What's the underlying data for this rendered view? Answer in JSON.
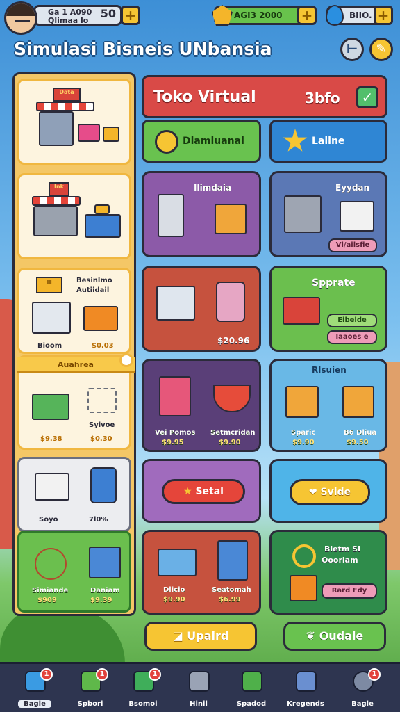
{
  "header": {
    "player_name": "Ga 1 A090",
    "player_level": "Qlimaa lo",
    "player_num": "50",
    "coins": "AGI3 2000",
    "diamonds": "BIIO.",
    "title": "Simulasi Bisneis UNbansia"
  },
  "left_panel": {
    "card3_title": "Besinlmo",
    "card3_sub": "Autiidail",
    "card3_label_a": "Bioom",
    "card3_price_a": "$0.03",
    "card4_banner": "Auahrea",
    "card4_price_a": "$9.38",
    "card4_label_b": "Syivoe",
    "card4_price_b": "$0.30",
    "card5_label_a": "Soyo",
    "card5_label_b": "7l0%",
    "card6_label_a": "Simiande",
    "card6_price_a": "$909",
    "card6_label_b": "Daniam",
    "card6_price_b": "$9.39"
  },
  "main": {
    "toko_title": "Toko Virtual",
    "toko_value": "3bfo",
    "btn_diam": "Diamluanal",
    "btn_lailne": "Lailne",
    "card_a_title": "Ilimdaia",
    "card_b_title": "Eyydan",
    "card_b_pill": "Vl/ailsfie",
    "card_c_price": "$20.96",
    "card_d_title": "Spprate",
    "card_d_pill1": "Eibelde",
    "card_d_pill2": "Iaaoes e",
    "card_e_label_a": "Vei Pomos",
    "card_e_price_a": "$9.95",
    "card_e_label_b": "Setmcridan",
    "card_e_price_b": "$9.90",
    "card_f_title": "Rlsuien",
    "card_f_label_a": "Sparic",
    "card_f_price_a": "$9.90",
    "card_f_label_b": "B6 Dliua",
    "card_f_price_b": "$9.50",
    "btn_setal": "Setal",
    "btn_svide": "Svide",
    "card_g_label_a": "Dlicio",
    "card_g_price_a": "$9.90",
    "card_g_label_b": "Seatomah",
    "card_g_price_b": "$6.99",
    "card_h_title": "Bletm Si",
    "card_h_sub": "Ooorlam",
    "card_h_pill": "Rard Fdy",
    "btn_upaid": "Upaird",
    "btn_oudale": "Oudale"
  },
  "nav": [
    {
      "label": "Bagle",
      "badge": "1",
      "icon": "home-icon",
      "color": "#3a9be3"
    },
    {
      "label": "Spbori",
      "badge": "1",
      "icon": "puzzle-icon",
      "color": "#5fb84a"
    },
    {
      "label": "Bsomoi",
      "badge": "1",
      "icon": "wrench-icon",
      "color": "#3fae5a"
    },
    {
      "label": "Hinil",
      "badge": "",
      "icon": "tools-icon",
      "color": "#9aa3b5"
    },
    {
      "label": "Spadod",
      "badge": "",
      "icon": "bin-icon",
      "color": "#4fb04a"
    },
    {
      "label": "Kregends",
      "badge": "",
      "icon": "box-icon",
      "color": "#6a8fd0"
    },
    {
      "label": "Bagle",
      "badge": "1",
      "icon": "gear-icon",
      "color": "#7d8aa3"
    }
  ]
}
